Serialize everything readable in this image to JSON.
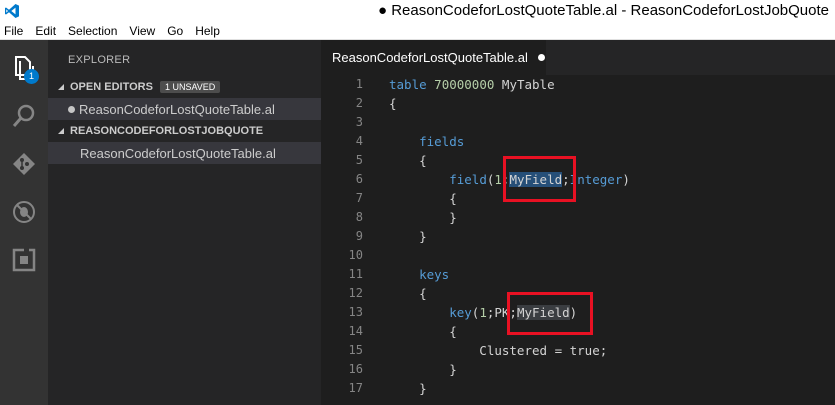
{
  "window": {
    "title": "● ReasonCodeforLostQuoteTable.al - ReasonCodeforLostJobQuote"
  },
  "menu": [
    "File",
    "Edit",
    "Selection",
    "View",
    "Go",
    "Help"
  ],
  "activity": {
    "explorer_badge": "1"
  },
  "sidebar": {
    "title": "EXPLORER",
    "open_editors": {
      "label": "OPEN EDITORS",
      "badge": "1 UNSAVED",
      "file": "ReasonCodeforLostQuoteTable.al"
    },
    "folder": {
      "label": "REASONCODEFORLOSTJOBQUOTE",
      "file": "ReasonCodeforLostQuoteTable.al"
    }
  },
  "tab": {
    "label": "ReasonCodeforLostQuoteTable.al"
  },
  "editor": {
    "line_numbers": [
      "1",
      "2",
      "3",
      "4",
      "5",
      "6",
      "7",
      "8",
      "9",
      "10",
      "11",
      "12",
      "13",
      "14",
      "15",
      "16",
      "17"
    ],
    "lines": [
      "table 70000000 MyTable",
      "{",
      "",
      "    fields",
      "    {",
      "        field(1;MyField;Integer)",
      "        {",
      "        }",
      "    }",
      "",
      "    keys",
      "    {",
      "        key(1;PK;MyField)",
      "        {",
      "            Clustered = true;",
      "        }",
      "    }"
    ]
  },
  "colors": {
    "accent": "#007acc",
    "highlight_box": "#e81123",
    "selection": "#264f78"
  }
}
